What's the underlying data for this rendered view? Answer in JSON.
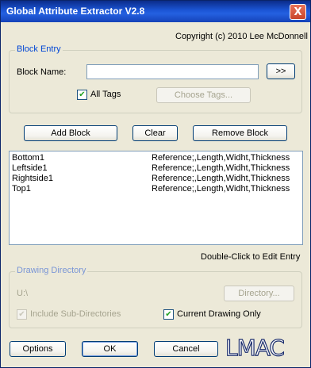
{
  "window": {
    "title": "Global Attribute Extractor V2.8",
    "close_label": "X"
  },
  "copyright": "Copyright (c) 2010 Lee McDonnell",
  "block_entry": {
    "legend": "Block Entry",
    "block_name_label": "Block Name:",
    "block_name_value": "",
    "add_arrow_label": ">>",
    "all_tags_label": "All Tags",
    "all_tags_checked": true,
    "choose_tags_label": "Choose Tags..."
  },
  "actions": {
    "add_block": "Add Block",
    "clear": "Clear",
    "remove_block": "Remove Block"
  },
  "block_list": {
    "rows": [
      {
        "name": "Bottom1",
        "tags": "Reference;,Length,Widht,Thickness"
      },
      {
        "name": "Leftside1",
        "tags": "Reference;,Length,Widht,Thickness"
      },
      {
        "name": "Rightside1",
        "tags": "Reference;,Length,Widht,Thickness"
      },
      {
        "name": "Top1",
        "tags": "Reference;,Length,Widht,Thickness"
      }
    ],
    "hint": "Double-Click to Edit Entry"
  },
  "drawing_directory": {
    "legend": "Drawing Directory",
    "path": "U:\\",
    "directory_button": "Directory...",
    "include_sub_label": "Include Sub-Directories",
    "include_sub_checked": true,
    "current_only_label": "Current Drawing Only",
    "current_only_checked": true
  },
  "footer": {
    "options": "Options",
    "ok": "OK",
    "cancel": "Cancel",
    "logo_text": "LMAC"
  },
  "colors": {
    "title_bar": "#1c56d6",
    "face": "#ece9d8",
    "legend_text": "#0046d5"
  }
}
